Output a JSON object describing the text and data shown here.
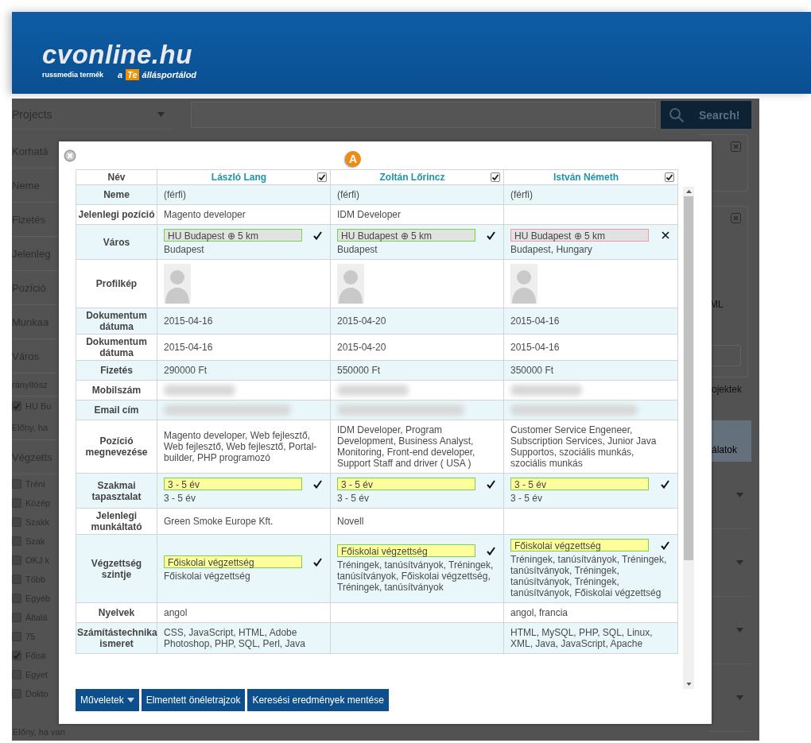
{
  "header": {
    "logo": "cvonline.hu",
    "publisher": "russmedia termék",
    "slogan_prefix": "a",
    "slogan_badge": "Te",
    "slogan_suffix": "állásportálod"
  },
  "background": {
    "project_select": {
      "label": "Projects"
    },
    "search_button": {
      "label": "Search!"
    },
    "sidebar": [
      {
        "kind": "heading",
        "label": "Korhatá"
      },
      {
        "kind": "heading",
        "label": "Neme"
      },
      {
        "kind": "heading",
        "label": "Fizetés"
      },
      {
        "kind": "heading",
        "label": "Jelenleg"
      },
      {
        "kind": "heading",
        "label": "Pozíció"
      },
      {
        "kind": "heading",
        "label": "Munkaa"
      },
      {
        "kind": "heading",
        "label": "Város"
      },
      {
        "kind": "small",
        "label": "rányítósz"
      },
      {
        "kind": "checkbox",
        "label": "HU Bu",
        "checked": true
      },
      {
        "kind": "note",
        "label": "Előny, ha"
      },
      {
        "kind": "heading",
        "label": "Végzetts"
      },
      {
        "kind": "checkbox",
        "label": "Tréni",
        "checked": false
      },
      {
        "kind": "checkbox",
        "label": "Közép",
        "checked": false
      },
      {
        "kind": "checkbox",
        "label": "Szakk",
        "checked": false
      },
      {
        "kind": "checkbox",
        "label": "Szak",
        "checked": false
      },
      {
        "kind": "checkbox",
        "label": "OKJ k",
        "checked": false
      },
      {
        "kind": "checkbox",
        "label": "Több",
        "checked": false
      },
      {
        "kind": "checkbox",
        "label": "Egyéb",
        "checked": false
      },
      {
        "kind": "checkbox",
        "label": "Általá",
        "checked": false
      },
      {
        "kind": "checkbox",
        "label": "75",
        "checked": false
      },
      {
        "kind": "checkbox",
        "label": "Főisk",
        "checked": true
      },
      {
        "kind": "checkbox",
        "label": "Egyet",
        "checked": false
      },
      {
        "kind": "checkbox",
        "label": "Dokto",
        "checked": false
      }
    ],
    "footer_note": "Előny, ha van",
    "right_fragments": {
      "card_text": "ML",
      "link_text": "ojektek",
      "panel_text": "álatok"
    }
  },
  "modal": {
    "badge": "A",
    "corner_label": "Név",
    "candidates": [
      {
        "name": "László Lang",
        "checked": true
      },
      {
        "name": "Zoltán Lőrincz",
        "checked": true
      },
      {
        "name": "István Németh",
        "checked": true
      }
    ],
    "rows": [
      {
        "label": "Neme",
        "cells": [
          {
            "kind": "text",
            "text": "(férfi)"
          },
          {
            "kind": "text",
            "text": "(férfi)"
          },
          {
            "kind": "text",
            "text": "(férfi)"
          }
        ]
      },
      {
        "label": "Jelenlegi pozíció",
        "cells": [
          {
            "kind": "text",
            "text": "Magento developer"
          },
          {
            "kind": "text",
            "text": "IDM Developer"
          },
          {
            "kind": "text"
          }
        ]
      },
      {
        "label": "Város",
        "cells": [
          {
            "kind": "match",
            "tag": "HU Budapest ⊕ 5 km",
            "highlight": false,
            "match": true,
            "text": "Budapest"
          },
          {
            "kind": "match",
            "tag": "HU Budapest ⊕ 5 km",
            "highlight": false,
            "match": true,
            "text": "Budapest"
          },
          {
            "kind": "match",
            "tag": "HU Budapest ⊕ 5 km",
            "highlight": false,
            "match": false,
            "text": "Budapest, Hungary"
          }
        ]
      },
      {
        "label": "Profilkép",
        "cells": [
          {
            "kind": "photo"
          },
          {
            "kind": "photo"
          },
          {
            "kind": "photo"
          }
        ]
      },
      {
        "label": "Dokumentum dátuma",
        "cells": [
          {
            "kind": "text",
            "text": "2015-04-16"
          },
          {
            "kind": "text",
            "text": "2015-04-20"
          },
          {
            "kind": "text",
            "text": "2015-04-16"
          }
        ]
      },
      {
        "label": "Dokumentum dátuma",
        "cells": [
          {
            "kind": "text",
            "text": "2015-04-16"
          },
          {
            "kind": "text",
            "text": "2015-04-20"
          },
          {
            "kind": "text",
            "text": "2015-04-16"
          }
        ]
      },
      {
        "label": "Fizetés",
        "cells": [
          {
            "kind": "text",
            "text": "290000 Ft"
          },
          {
            "kind": "text",
            "text": "550000 Ft"
          },
          {
            "kind": "text",
            "text": "350000 Ft"
          }
        ]
      },
      {
        "label": "Mobilszám",
        "cells": [
          {
            "kind": "redacted"
          },
          {
            "kind": "redacted"
          },
          {
            "kind": "redacted"
          }
        ]
      },
      {
        "label": "Email cím",
        "cells": [
          {
            "kind": "redacted"
          },
          {
            "kind": "redacted"
          },
          {
            "kind": "redacted"
          }
        ]
      },
      {
        "label": "Pozíció megnevezése",
        "cells": [
          {
            "kind": "text",
            "text": "Magento developer, Web fejlesztő, Web fejlesztő, Web fejlesztő, Portal-builder, PHP programozó"
          },
          {
            "kind": "text",
            "text": "IDM Developer, Program Development, Business Analyst, Monitoring, Front-end developer, Support Staff and driver ( USA )"
          },
          {
            "kind": "text",
            "text": "Customer Service Engeneer, Subscription Services, Junior Java Supportos, szociális munkás, szociális munkás"
          }
        ]
      },
      {
        "label": "Szakmai tapasztalat",
        "cells": [
          {
            "kind": "match",
            "tag": "3 - 5 év",
            "highlight": true,
            "match": true,
            "text": "3 - 5 év"
          },
          {
            "kind": "match",
            "tag": "3 - 5 év",
            "highlight": true,
            "match": true,
            "text": "3 - 5 év"
          },
          {
            "kind": "match",
            "tag": "3 - 5 év",
            "highlight": true,
            "match": true,
            "text": "3 - 5 év"
          }
        ]
      },
      {
        "label": "Jelenlegi munkáltató",
        "cells": [
          {
            "kind": "text",
            "text": "Green Smoke Europe Kft."
          },
          {
            "kind": "text",
            "text": "Novell"
          },
          {
            "kind": "text"
          }
        ]
      },
      {
        "label": "Végzettség szintje",
        "cells": [
          {
            "kind": "match",
            "tag": "Főiskolai végzettség",
            "highlight": true,
            "match": true,
            "text": "Főiskolai végzettség"
          },
          {
            "kind": "match",
            "tag": "Főiskolai végzettség",
            "highlight": true,
            "match": true,
            "text": "Tréningek, tanúsítványok, Tréningek, tanúsítványok, Főiskolai végzettség, Tréningek, tanúsítványok"
          },
          {
            "kind": "match",
            "tag": "Főiskolai végzettség",
            "highlight": true,
            "match": true,
            "text": "Tréningek, tanúsítványok, Tréningek, tanúsítványok, Tréningek, tanúsítványok, Tréningek, tanúsítványok, Főiskolai végzettség"
          }
        ]
      },
      {
        "label": "Nyelvek",
        "cells": [
          {
            "kind": "text",
            "text": "angol"
          },
          {
            "kind": "text"
          },
          {
            "kind": "text",
            "text": "angol, francia"
          }
        ]
      },
      {
        "label": "Számítástechnika ismeret",
        "cells": [
          {
            "kind": "text",
            "text": "CSS, JavaScript, HTML, Adobe Photoshop, PHP, SQL, Perl, Java"
          },
          {
            "kind": "text"
          },
          {
            "kind": "text",
            "text": "HTML, MySQL, PHP, SQL, Linux, XML, Java, JavaScript, Apache"
          }
        ]
      }
    ],
    "buttons": [
      {
        "label": "Műveletek",
        "kind": "menu"
      },
      {
        "label": "Elmentett önéletrajzok",
        "kind": "plain"
      },
      {
        "label": "Keresési eredmények mentése",
        "kind": "plain"
      }
    ]
  }
}
